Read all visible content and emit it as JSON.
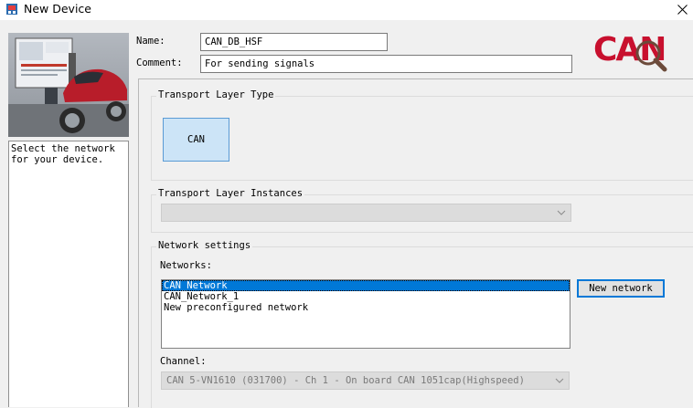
{
  "window": {
    "title": "New Device"
  },
  "sidebar": {
    "description": "Select the network\nfor your device."
  },
  "form": {
    "name_label": "Name:",
    "name_value": "CAN_DB_HSF",
    "comment_label": "Comment:",
    "comment_value": "For sending signals"
  },
  "logo": {
    "text": "CAN"
  },
  "transport_type": {
    "title": "Transport Layer Type",
    "tile_label": "CAN"
  },
  "transport_instances": {
    "title": "Transport Layer Instances",
    "value": ""
  },
  "network_settings": {
    "title": "Network settings",
    "networks_label": "Networks:",
    "networks": [
      "CAN_Network",
      "CAN_Network_1",
      "New preconfigured network"
    ],
    "selected_index": 0,
    "new_network_button": "New network",
    "channel_label": "Channel:",
    "channel_value": "CAN 5-VN1610 (031700) - Ch 1 - On board CAN 1051cap(Highspeed)"
  },
  "colors": {
    "accent": "#0078d7",
    "tile_bg": "#cce4f7",
    "logo_red": "#c8102e"
  }
}
